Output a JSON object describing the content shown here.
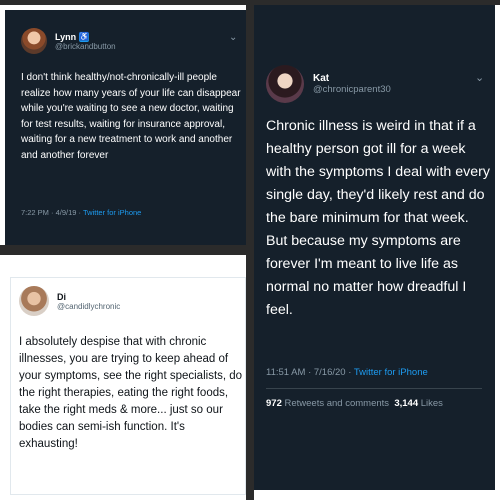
{
  "tweets": [
    {
      "name": "Lynn",
      "handle": "@brickandbutton",
      "text": "I don't think healthy/not-chronically-ill people realize how many years of your life can disappear while you're waiting to see a new doctor, waiting for test results, waiting for insurance approval, waiting for a new treatment to work and another and another forever",
      "timestamp": "7:22 PM · 4/9/19 · ",
      "client": "Twitter for iPhone",
      "chevron": "⌄"
    },
    {
      "name": "Kat",
      "handle": "@chronicparent30",
      "text": "Chronic illness is weird in that if a healthy person got ill for a week with the symptoms I deal with every single day, they'd likely rest and do the bare minimum for that week. But because my symptoms are forever I'm meant to live life as normal no matter how dreadful I feel.",
      "timestamp": "11:51 AM · 7/16/20 · ",
      "client": "Twitter for iPhone",
      "retweets_count": "972",
      "retweets_label": "Retweets and comments",
      "likes_count": "3,144",
      "likes_label": "Likes",
      "chevron": "⌄"
    },
    {
      "name": "Di",
      "handle": "@candidlychronic",
      "text": "I absolutely despise that with chronic illnesses, you are trying to keep ahead of your symptoms, see the right specialists, do the right therapies, eating the right foods, take the right meds & more... just so our bodies can semi-ish function. It's exhausting!"
    }
  ]
}
